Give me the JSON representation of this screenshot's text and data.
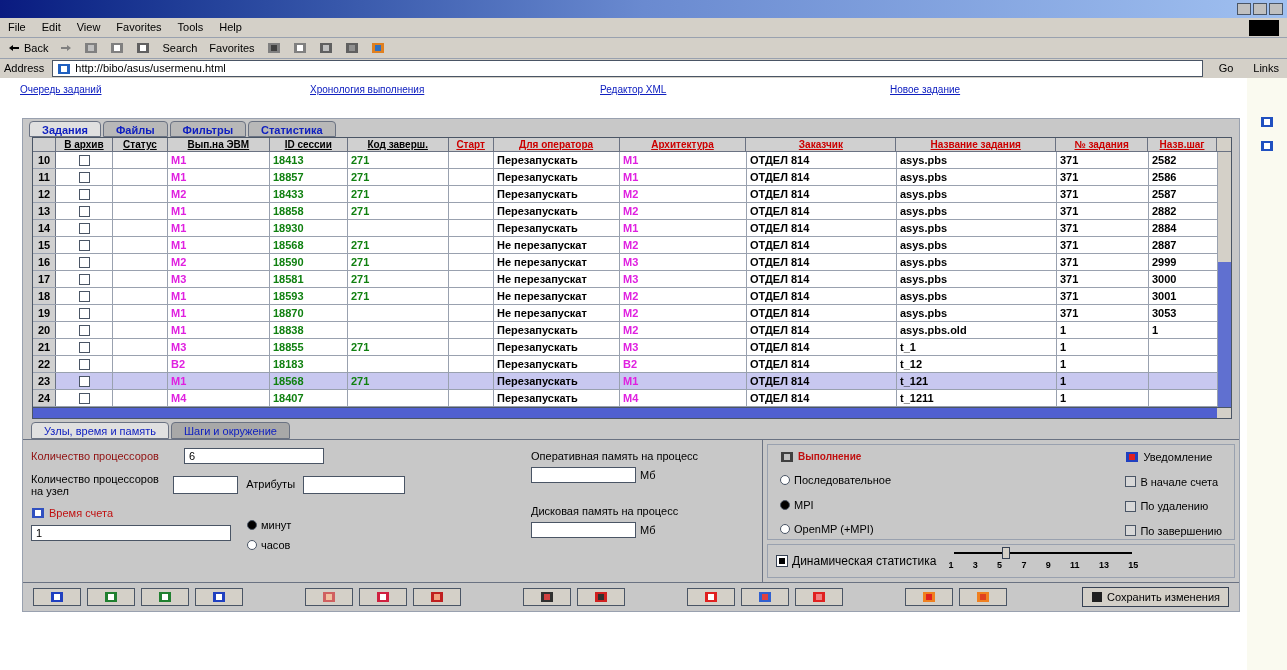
{
  "browser": {
    "menu": [
      "File",
      "Edit",
      "View",
      "Favorites",
      "Tools",
      "Help"
    ],
    "back": "Back",
    "search": "Search",
    "favorites": "Favorites",
    "address_label": "Address",
    "address": "http://bibo/asus/usermenu.html",
    "go": "Go",
    "links": "Links"
  },
  "nav_links": [
    "Очередь заданий",
    "Хронология выполнения",
    "Редактор XML",
    "Новое задание"
  ],
  "tabs": [
    {
      "label": "Задания",
      "selected": true
    },
    {
      "label": "Файлы",
      "selected": false
    },
    {
      "label": "Фильтры",
      "selected": false
    },
    {
      "label": "Статистика",
      "selected": false
    }
  ],
  "table": {
    "columns": [
      {
        "label": "В архив",
        "color": "#000000"
      },
      {
        "label": "Статус",
        "color": "#000000"
      },
      {
        "label": "Вып.на ЭВМ",
        "color": "#000000"
      },
      {
        "label": "ID сессии",
        "color": "#000000"
      },
      {
        "label": "Код заверш.",
        "color": "#000000"
      },
      {
        "label": "Старт",
        "color": "#cc0000"
      },
      {
        "label": "Для оператора",
        "color": "#cc0000"
      },
      {
        "label": "Архитектура",
        "color": "#cc0000"
      },
      {
        "label": "Заказчик",
        "color": "#cc0000"
      },
      {
        "label": "Название задания",
        "color": "#cc0000"
      },
      {
        "label": "№ задания",
        "color": "#cc0000"
      },
      {
        "label": "Назв.шаг",
        "color": "#cc0000"
      }
    ],
    "rows": [
      {
        "num": "10",
        "archive": false,
        "evm": "М1",
        "session": "18413",
        "code": "271",
        "operator": "Перезапускать",
        "arch": "М1",
        "customer": "ОТДЕЛ 814",
        "name": "asys.pbs",
        "job": "371",
        "step": "2582",
        "selected": false
      },
      {
        "num": "11",
        "archive": false,
        "evm": "М1",
        "session": "18857",
        "code": "271",
        "operator": "Перезапускать",
        "arch": "М1",
        "customer": "ОТДЕЛ 814",
        "name": "asys.pbs",
        "job": "371",
        "step": "2586",
        "selected": false
      },
      {
        "num": "12",
        "archive": false,
        "evm": "М2",
        "session": "18433",
        "code": "271",
        "operator": "Перезапускать",
        "arch": "М2",
        "customer": "ОТДЕЛ 814",
        "name": "asys.pbs",
        "job": "371",
        "step": "2587",
        "selected": false
      },
      {
        "num": "13",
        "archive": false,
        "evm": "М1",
        "session": "18858",
        "code": "271",
        "operator": "Перезапускать",
        "arch": "М2",
        "customer": "ОТДЕЛ 814",
        "name": "asys.pbs",
        "job": "371",
        "step": "2882",
        "selected": false
      },
      {
        "num": "14",
        "archive": false,
        "evm": "М1",
        "session": "18930",
        "code": "",
        "operator": "Перезапускать",
        "arch": "М1",
        "customer": "ОТДЕЛ 814",
        "name": "asys.pbs",
        "job": "371",
        "step": "2884",
        "selected": false
      },
      {
        "num": "15",
        "archive": false,
        "evm": "М1",
        "session": "18568",
        "code": "271",
        "operator": "Не перезапускат",
        "arch": "М2",
        "customer": "ОТДЕЛ 814",
        "name": "asys.pbs",
        "job": "371",
        "step": "2887",
        "selected": false
      },
      {
        "num": "16",
        "archive": false,
        "evm": "М2",
        "session": "18590",
        "code": "271",
        "operator": "Не перезапускат",
        "arch": "М3",
        "customer": "ОТДЕЛ 814",
        "name": "asys.pbs",
        "job": "371",
        "step": "2999",
        "selected": false
      },
      {
        "num": "17",
        "archive": false,
        "evm": "М3",
        "session": "18581",
        "code": "271",
        "operator": "Не перезапускат",
        "arch": "М3",
        "customer": "ОТДЕЛ 814",
        "name": "asys.pbs",
        "job": "371",
        "step": "3000",
        "selected": false
      },
      {
        "num": "18",
        "archive": false,
        "evm": "М1",
        "session": "18593",
        "code": "271",
        "operator": "Не перезапускат",
        "arch": "М2",
        "customer": "ОТДЕЛ 814",
        "name": "asys.pbs",
        "job": "371",
        "step": "3001",
        "selected": false
      },
      {
        "num": "19",
        "archive": false,
        "evm": "М1",
        "session": "18870",
        "code": "",
        "operator": "Не перезапускат",
        "arch": "М2",
        "customer": "ОТДЕЛ 814",
        "name": "asys.pbs",
        "job": "371",
        "step": "3053",
        "selected": false
      },
      {
        "num": "20",
        "archive": false,
        "evm": "М1",
        "session": "18838",
        "code": "",
        "operator": "Перезапускать",
        "arch": "М2",
        "customer": "ОТДЕЛ 814",
        "name": "asys.pbs.old",
        "job": "1",
        "step": "1",
        "selected": false
      },
      {
        "num": "21",
        "archive": false,
        "evm": "М3",
        "session": "18855",
        "code": "271",
        "operator": "Перезапускать",
        "arch": "М3",
        "customer": "ОТДЕЛ 814",
        "name": "t_1",
        "job": "1",
        "step": "",
        "selected": false
      },
      {
        "num": "22",
        "archive": false,
        "evm": "В2",
        "session": "18183",
        "code": "",
        "operator": "Перезапускать",
        "arch": "В2",
        "customer": "ОТДЕЛ 814",
        "name": "t_12",
        "job": "1",
        "step": "",
        "selected": false
      },
      {
        "num": "23",
        "archive": false,
        "evm": "М1",
        "session": "18568",
        "code": "271",
        "operator": "Перезапускать",
        "arch": "М1",
        "customer": "ОТДЕЛ 814",
        "name": "t_121",
        "job": "1",
        "step": "",
        "selected": true
      },
      {
        "num": "24",
        "archive": false,
        "evm": "М4",
        "session": "18407",
        "code": "",
        "operator": "Перезапускать",
        "arch": "М4",
        "customer": "ОТДЕЛ 814",
        "name": "t_1211",
        "job": "1",
        "step": "",
        "selected": false
      }
    ]
  },
  "bottom_tabs": [
    {
      "label": "Узлы, время и память",
      "selected": true
    },
    {
      "label": "Шаги и окружение",
      "selected": false
    }
  ],
  "form": {
    "processors_label": "Количество процессоров",
    "processors": "6",
    "per_node_label": "Количество процессоров на узел",
    "attributes_label": "Атрибуты",
    "time_label": "Время счета",
    "time": "1",
    "time_units": [
      {
        "label": "минут",
        "selected": true
      },
      {
        "label": "часов",
        "selected": false
      }
    ],
    "ram_label": "Оперативная память на процесс",
    "ram_unit": "Мб",
    "disk_label": "Дисковая память на процесс",
    "disk_unit": "Мб"
  },
  "execution": {
    "title": "Выполнение",
    "modes": [
      {
        "label": "Последовательное",
        "selected": false
      },
      {
        "label": "MPI",
        "selected": true
      },
      {
        "label": "OpenMP (+MPI)",
        "selected": false
      }
    ]
  },
  "notification": {
    "title": "Уведомление",
    "options": [
      {
        "label": "В начале счета",
        "checked": false
      },
      {
        "label": "По удалению",
        "checked": false
      },
      {
        "label": "По завершению",
        "checked": false
      }
    ]
  },
  "statistics": {
    "label": "Динамическая статистика",
    "checked": true,
    "level": 0.29,
    "ticks": [
      "1",
      "3",
      "5",
      "7",
      "9",
      "11",
      "13",
      "15"
    ]
  },
  "save_button": "Сохранить изменения"
}
